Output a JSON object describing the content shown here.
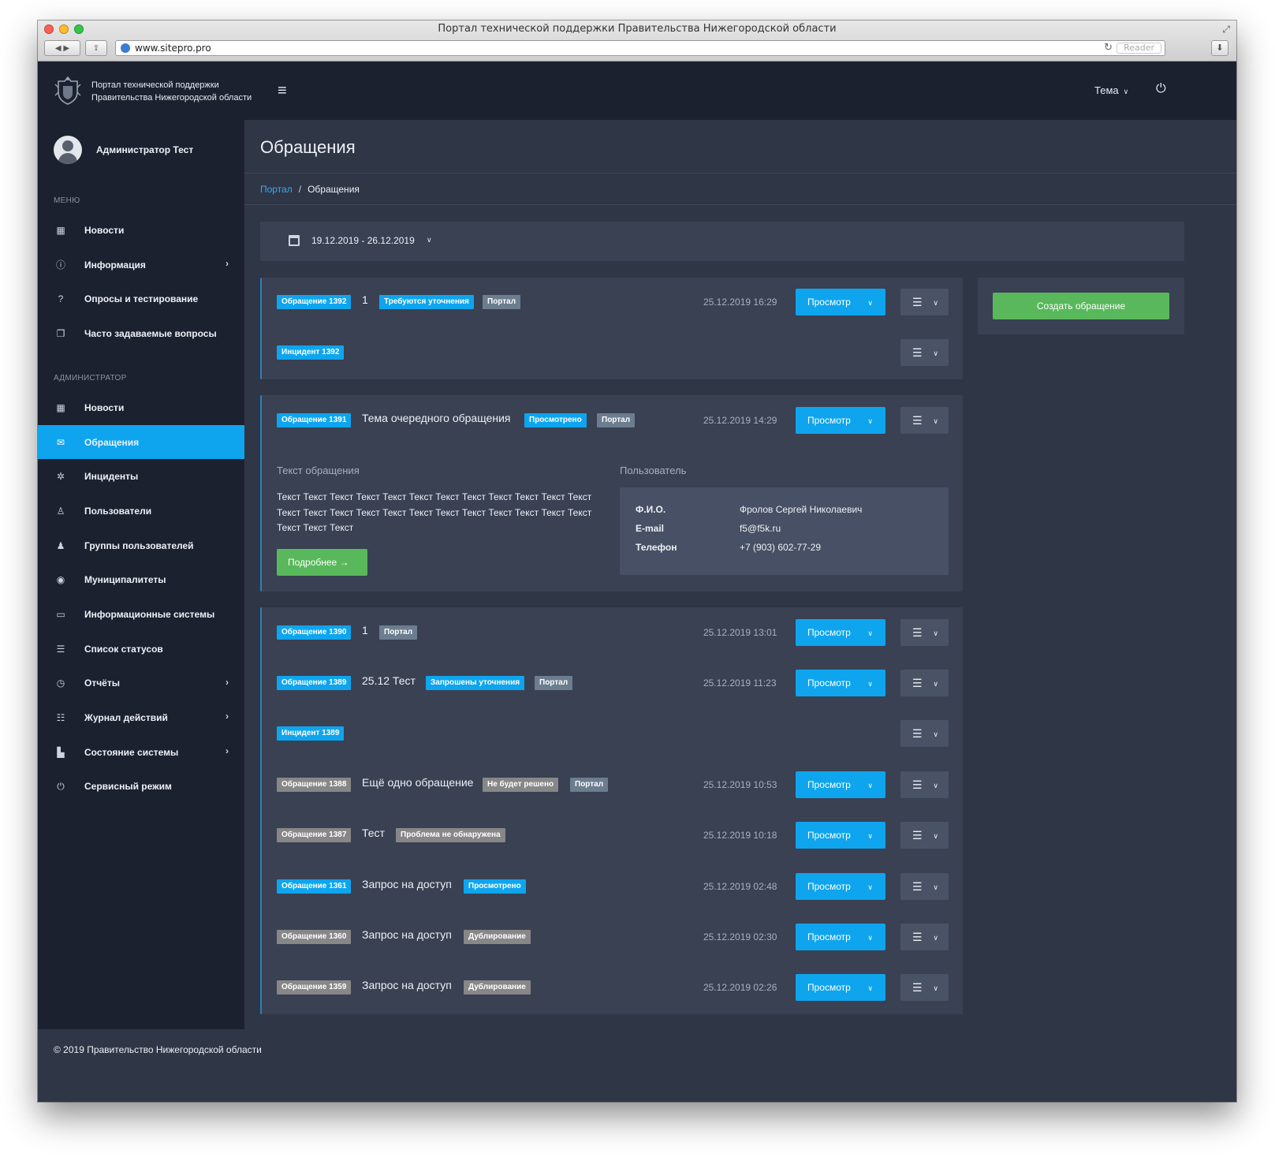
{
  "browser": {
    "window_title": "Портал технической поддержки Правительства Нижегородской области",
    "url": "www.sitepro.pro",
    "reader_label": "Reader"
  },
  "header": {
    "brand_line1": "Портал технической поддержки",
    "brand_line2": "Правительства Нижегородской области",
    "theme_label": "Тема"
  },
  "sidebar": {
    "user_name": "Администратор Тест",
    "menu_label": "МЕНЮ",
    "menu_items": [
      {
        "label": "Новости",
        "icon": "newspaper-icon"
      },
      {
        "label": "Информация",
        "icon": "info-icon",
        "has_arrow": true
      },
      {
        "label": "Опросы и тестирование",
        "icon": "question-icon"
      },
      {
        "label": "Часто задаваемые вопросы",
        "icon": "chat-icon"
      }
    ],
    "admin_label": "АДМИНИСТРАТОР",
    "admin_items": [
      {
        "label": "Новости",
        "icon": "newspaper-icon"
      },
      {
        "label": "Обращения",
        "icon": "envelope-icon",
        "active": true
      },
      {
        "label": "Инциденты",
        "icon": "bug-icon"
      },
      {
        "label": "Пользователи",
        "icon": "user-icon"
      },
      {
        "label": "Группы пользователей",
        "icon": "users-group-icon"
      },
      {
        "label": "Муниципалитеты",
        "icon": "globe-icon"
      },
      {
        "label": "Информационные системы",
        "icon": "monitor-icon"
      },
      {
        "label": "Список статусов",
        "icon": "list-icon"
      },
      {
        "label": "Отчёты",
        "icon": "clock-icon",
        "has_arrow": true
      },
      {
        "label": "Журнал действий",
        "icon": "checklist-icon",
        "has_arrow": true
      },
      {
        "label": "Состояние системы",
        "icon": "bar-chart-icon",
        "has_arrow": true
      },
      {
        "label": "Сервисный режим",
        "icon": "power-icon"
      }
    ]
  },
  "page": {
    "title": "Обращения",
    "breadcrumb_root": "Портал",
    "breadcrumb_sep": "/",
    "breadcrumb_current": "Обращения",
    "date_range": "19.12.2019 - 26.12.2019",
    "view_label": "Просмотр",
    "create_label": "Создать обращение"
  },
  "appeals": {
    "a1392": {
      "id": "Обращение 1392",
      "title": "1",
      "status": "Требуются уточнения",
      "source": "Портал",
      "date": "25.12.2019 16:29",
      "incident": "Инцидент 1392"
    },
    "a1391": {
      "id": "Обращение 1391",
      "title": "Тема очередного обращения",
      "status": "Просмотрено",
      "source": "Портал",
      "date": "25.12.2019 14:29",
      "text_label": "Текст обращения",
      "text": "Текст Текст Текст Текст Текст Текст Текст Текст Текст Текст Текст Текст Текст Текст Текст Текст Текст Текст Текст Текст Текст Текст Текст Текст Текст Текст Текст",
      "more_label": "Подробнее",
      "user_label": "Пользователь",
      "fio_key": "Ф.И.О.",
      "fio": "Фролов Сергей Николаевич",
      "email_key": "E-mail",
      "email": "f5@f5k.ru",
      "phone_key": "Телефон",
      "phone": "+7 (903) 602-77-29"
    },
    "a1390": {
      "id": "Обращение 1390",
      "title": "1",
      "source": "Портал",
      "date": "25.12.2019 13:01"
    },
    "a1389": {
      "id": "Обращение 1389",
      "title": "25.12 Тест",
      "status": "Запрошены уточнения",
      "source": "Портал",
      "date": "25.12.2019 11:23",
      "incident": "Инцидент 1389"
    },
    "a1388": {
      "id": "Обращение 1388",
      "title": "Ещё одно обращение",
      "status": "Не будет решено",
      "source": "Портал",
      "date": "25.12.2019 10:53"
    },
    "a1387": {
      "id": "Обращение 1387",
      "title": "Тест",
      "status": "Проблема не обнаружена",
      "date": "25.12.2019 10:18"
    },
    "a1361": {
      "id": "Обращение 1361",
      "title": "Запрос на доступ",
      "status": "Просмотрено",
      "date": "25.12.2019 02:48"
    },
    "a1360": {
      "id": "Обращение 1360",
      "title": "Запрос на доступ",
      "status": "Дублирование",
      "date": "25.12.2019 02:30"
    },
    "a1359": {
      "id": "Обращение 1359",
      "title": "Запрос на доступ",
      "status": "Дублирование",
      "date": "25.12.2019 02:26"
    }
  },
  "footer": {
    "text": "© 2019  Правительство Нижегородской области"
  },
  "colors": {
    "accent": "#0ea5ee",
    "success": "#58b85b",
    "sidebar": "#1c2130",
    "content": "#2f3646",
    "card": "#394153"
  }
}
